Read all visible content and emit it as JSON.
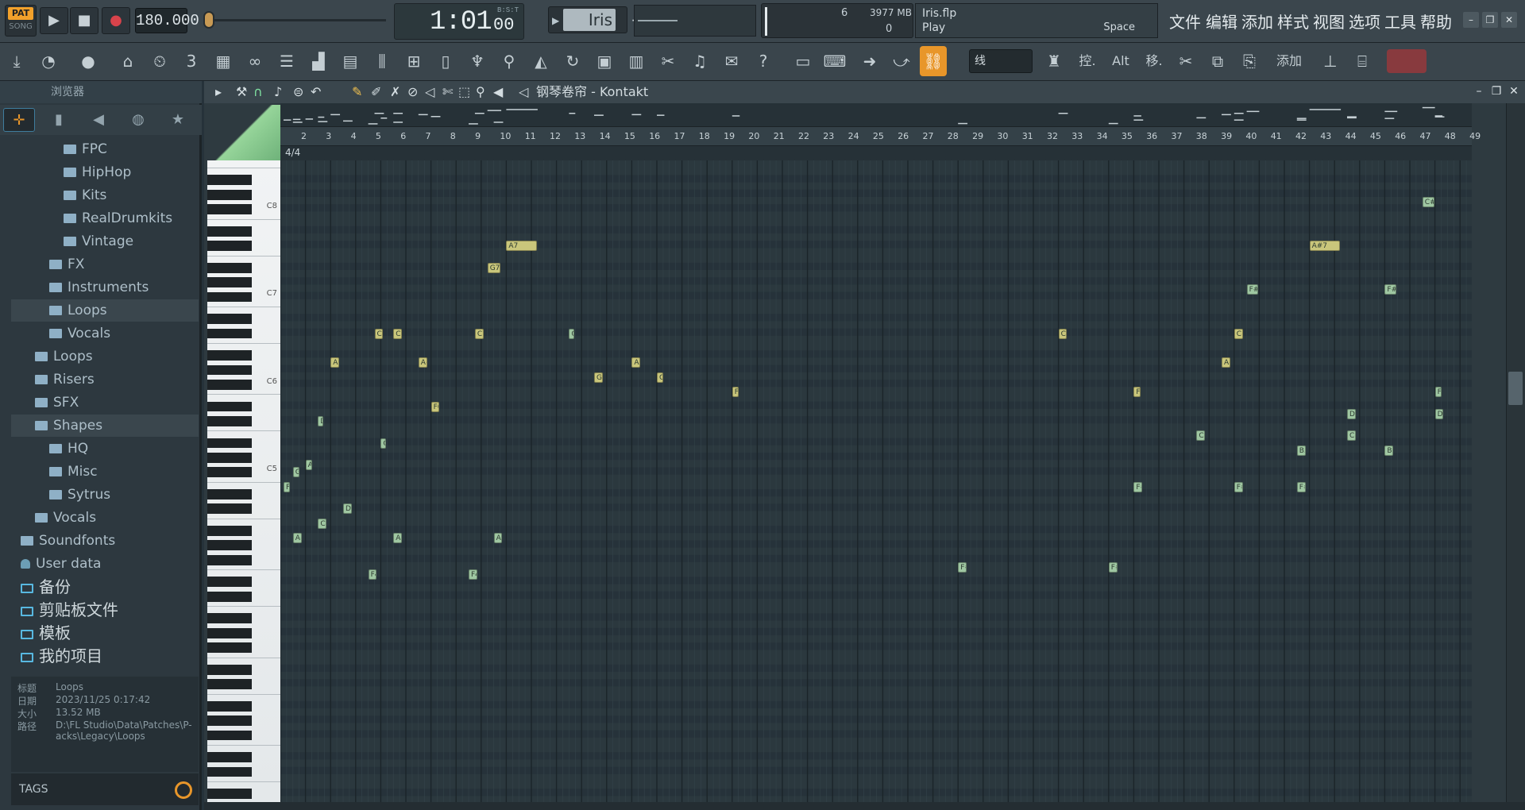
{
  "transport": {
    "pat_label": "PAT",
    "song_label": "SONG",
    "tempo": "180.000"
  },
  "time_display": {
    "main": "1:01",
    "sub": "00",
    "unit": "B:S:T"
  },
  "pattern": {
    "name": "Iris"
  },
  "cpu": {
    "polyphony": "6",
    "memory": "3977 MB",
    "count": "0"
  },
  "hint": {
    "file": "Iris.flp",
    "action": "Play",
    "shortcut": "Space"
  },
  "menu": [
    "文件",
    "编辑",
    "添加",
    "样式",
    "视图",
    "选项",
    "工具",
    "帮助"
  ],
  "toolbar2": {
    "snap": "线",
    "alt_label": "Alt",
    "ctrl_label": "控.",
    "move_label": "移.",
    "add_label": "添加"
  },
  "browser": {
    "title": "浏览器",
    "tree": [
      {
        "label": "FPC",
        "level": 3
      },
      {
        "label": "HipHop",
        "level": 3
      },
      {
        "label": "Kits",
        "level": 3
      },
      {
        "label": "RealDrumkits",
        "level": 3
      },
      {
        "label": "Vintage",
        "level": 3
      },
      {
        "label": "FX",
        "level": 2
      },
      {
        "label": "Instruments",
        "level": 2
      },
      {
        "label": "Loops",
        "level": 2,
        "selected": true
      },
      {
        "label": "Vocals",
        "level": 2
      },
      {
        "label": "Loops",
        "level": 1
      },
      {
        "label": "Risers",
        "level": 1
      },
      {
        "label": "SFX",
        "level": 1
      },
      {
        "label": "Shapes",
        "level": 1,
        "selected": true
      },
      {
        "label": "HQ",
        "level": 2
      },
      {
        "label": "Misc",
        "level": 2
      },
      {
        "label": "Sytrus",
        "level": 2
      },
      {
        "label": "Vocals",
        "level": 1
      },
      {
        "label": "Soundfonts",
        "level": 0
      },
      {
        "label": "User data",
        "level": 0
      },
      {
        "label": "备份",
        "level": 0,
        "cn": true
      },
      {
        "label": "剪贴板文件",
        "level": 0,
        "cn": true
      },
      {
        "label": "模板",
        "level": 0,
        "cn": true
      },
      {
        "label": "我的项目",
        "level": 0,
        "cn": true
      }
    ],
    "info": [
      {
        "key": "标题",
        "value": "Loops"
      },
      {
        "key": "日期",
        "value": "2023/11/25 0:17:42"
      },
      {
        "key": "大小",
        "value": "13.52 MB"
      },
      {
        "key": "路径",
        "value": "D:\\FL Studio\\Data\\Patches\\P-acks\\Legacy\\Loops"
      }
    ],
    "tags_label": "TAGS"
  },
  "roll": {
    "title": "钢琴卷帘 - Kontakt",
    "time_sig": "4/4",
    "bars": [
      "2",
      "3",
      "4",
      "5",
      "6",
      "7",
      "8",
      "9",
      "10",
      "11",
      "12",
      "13",
      "14",
      "15",
      "16",
      "17",
      "18",
      "19",
      "20",
      "21",
      "22",
      "23",
      "24",
      "25",
      "26",
      "27",
      "28",
      "29",
      "30",
      "31",
      "32",
      "33",
      "34",
      "35",
      "36",
      "37",
      "38",
      "39",
      "40",
      "41",
      "42",
      "43",
      "44",
      "45",
      "46",
      "47",
      "48",
      "49"
    ],
    "octave_labels": [
      {
        "label": "C8"
      },
      {
        "label": "C7"
      },
      {
        "label": "C6"
      },
      {
        "label": "C5"
      }
    ],
    "notes": [
      {
        "label": "A7",
        "color": "yellow",
        "beat": 36.0,
        "len": 5.0,
        "pitch": 97
      },
      {
        "label": "A#7",
        "color": "yellow",
        "beat": 164.0,
        "len": 5.0,
        "pitch": 97
      },
      {
        "label": "G7",
        "color": "yellow",
        "beat": 33.0,
        "len": 2.2,
        "pitch": 94
      },
      {
        "label": "C#8",
        "color": "green",
        "beat": 182.0,
        "len": 2.0,
        "pitch": 103
      },
      {
        "label": "F#7",
        "color": "green",
        "beat": 154.0,
        "len": 2.0,
        "pitch": 91
      },
      {
        "label": "F#7",
        "color": "green",
        "beat": 176.0,
        "len": 2.0,
        "pitch": 91
      },
      {
        "label": "C7",
        "color": "yellow",
        "beat": 15.0,
        "len": 1.5,
        "pitch": 85
      },
      {
        "label": "C7",
        "color": "yellow",
        "beat": 18.0,
        "len": 1.5,
        "pitch": 85
      },
      {
        "label": "C7",
        "color": "yellow",
        "beat": 31.0,
        "len": 1.5,
        "pitch": 85
      },
      {
        "label": "C7",
        "color": "green",
        "beat": 46.0,
        "len": 1.0,
        "pitch": 85
      },
      {
        "label": "C#7",
        "color": "yellow",
        "beat": 124.0,
        "len": 1.5,
        "pitch": 85
      },
      {
        "label": "C#7",
        "color": "yellow",
        "beat": 152.0,
        "len": 1.5,
        "pitch": 85
      },
      {
        "label": "A6",
        "color": "yellow",
        "beat": 8.0,
        "len": 1.5,
        "pitch": 81
      },
      {
        "label": "A#6",
        "color": "yellow",
        "beat": 22.0,
        "len": 1.5,
        "pitch": 81
      },
      {
        "label": "A#6",
        "color": "yellow",
        "beat": 56.0,
        "len": 1.5,
        "pitch": 81
      },
      {
        "label": "A#6",
        "color": "yellow",
        "beat": 150.0,
        "len": 1.5,
        "pitch": 81
      },
      {
        "label": "G6",
        "color": "yellow",
        "beat": 50.0,
        "len": 1.5,
        "pitch": 79
      },
      {
        "label": "G",
        "color": "yellow",
        "beat": 60.0,
        "len": 1.2,
        "pitch": 79
      },
      {
        "label": "F6",
        "color": "yellow",
        "beat": 72.0,
        "len": 1.2,
        "pitch": 77
      },
      {
        "label": "F#6",
        "color": "yellow",
        "beat": 136.0,
        "len": 1.2,
        "pitch": 77
      },
      {
        "label": "F#6",
        "color": "green",
        "beat": 184.0,
        "len": 1.2,
        "pitch": 77
      },
      {
        "label": "F6",
        "color": "yellow",
        "beat": 24.0,
        "len": 1.5,
        "pitch": 75
      },
      {
        "label": "D#6",
        "color": "green",
        "beat": 170.0,
        "len": 1.5,
        "pitch": 74
      },
      {
        "label": "D#6",
        "color": "green",
        "beat": 184.0,
        "len": 1.5,
        "pitch": 74
      },
      {
        "label": "D6",
        "color": "green",
        "beat": 6.0,
        "len": 1.0,
        "pitch": 73
      },
      {
        "label": "C#6",
        "color": "green",
        "beat": 146.0,
        "len": 1.5,
        "pitch": 71
      },
      {
        "label": "C#6",
        "color": "green",
        "beat": 170.0,
        "len": 1.5,
        "pitch": 71
      },
      {
        "label": "C6",
        "color": "green",
        "beat": 16.0,
        "len": 1.0,
        "pitch": 70
      },
      {
        "label": "B5",
        "color": "green",
        "beat": 162.0,
        "len": 1.5,
        "pitch": 69
      },
      {
        "label": "B5",
        "color": "green",
        "beat": 176.0,
        "len": 1.5,
        "pitch": 69
      },
      {
        "label": "A5",
        "color": "green",
        "beat": 4.0,
        "len": 1.2,
        "pitch": 67
      },
      {
        "label": "G5",
        "color": "green",
        "beat": 2.0,
        "len": 1.2,
        "pitch": 66
      },
      {
        "label": "F5",
        "color": "green",
        "beat": 0.5,
        "len": 1.2,
        "pitch": 64
      },
      {
        "label": "F#5",
        "color": "green",
        "beat": 136.0,
        "len": 1.5,
        "pitch": 64
      },
      {
        "label": "F#5",
        "color": "green",
        "beat": 152.0,
        "len": 1.5,
        "pitch": 64
      },
      {
        "label": "F#5",
        "color": "green",
        "beat": 162.0,
        "len": 1.5,
        "pitch": 64
      },
      {
        "label": "D5",
        "color": "green",
        "beat": 10.0,
        "len": 1.5,
        "pitch": 61
      },
      {
        "label": "C5",
        "color": "green",
        "beat": 6.0,
        "len": 1.5,
        "pitch": 59
      },
      {
        "label": "A#4",
        "color": "green",
        "beat": 2.0,
        "len": 1.5,
        "pitch": 57
      },
      {
        "label": "A#4",
        "color": "green",
        "beat": 18.0,
        "len": 1.5,
        "pitch": 57
      },
      {
        "label": "A#4",
        "color": "green",
        "beat": 34.0,
        "len": 1.5,
        "pitch": 57
      },
      {
        "label": "F4",
        "color": "green",
        "beat": 14.0,
        "len": 1.5,
        "pitch": 52
      },
      {
        "label": "F4",
        "color": "green",
        "beat": 30.0,
        "len": 1.5,
        "pitch": 52
      },
      {
        "label": "F#4",
        "color": "green",
        "beat": 108.0,
        "len": 1.5,
        "pitch": 53
      },
      {
        "label": "F#4",
        "color": "green",
        "beat": 132.0,
        "len": 1.5,
        "pitch": 53
      }
    ]
  }
}
